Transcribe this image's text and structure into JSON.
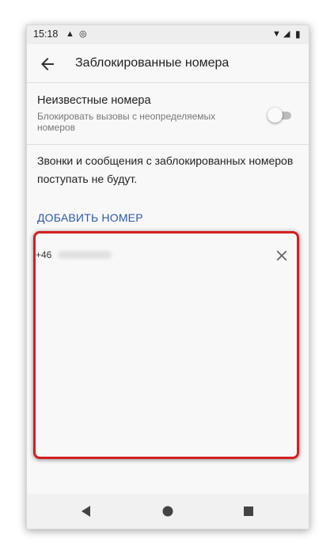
{
  "status_bar": {
    "time": "15:18",
    "left_icons": [
      "warning-icon",
      "sync-icon"
    ],
    "right_icons": [
      "wifi-icon",
      "signal-icon",
      "battery-icon"
    ]
  },
  "app_bar": {
    "back_icon": "arrow-back-icon",
    "title": "Заблокированные номера"
  },
  "unknown_numbers": {
    "title": "Неизвестные номера",
    "subtitle": "Блокировать вызовы с неопределяемых номеров",
    "toggle_on": false
  },
  "info_text": "Звонки и сообщения с заблокированных номеров поступать не будут.",
  "add_number_label": "ДОБАВИТЬ НОМЕР",
  "blocked_numbers": [
    {
      "number": "+46",
      "remove_icon": "close-icon"
    }
  ],
  "highlight_color": "#d41f1f",
  "accent_color": "#2e5aa8",
  "nav_bar": {
    "icons": [
      "back-triangle-icon",
      "home-circle-icon",
      "recents-square-icon"
    ]
  }
}
